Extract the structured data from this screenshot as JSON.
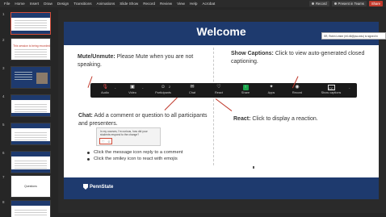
{
  "ribbon": {
    "menu": [
      "File",
      "Home",
      "Insert",
      "Draw",
      "Design",
      "Transitions",
      "Animations",
      "Slide Show",
      "Record",
      "Review",
      "View",
      "Help",
      "Acrobat"
    ],
    "record_label": "Record",
    "present_label": "Present in Teams",
    "share_label": "Share"
  },
  "thumbnails": [
    {
      "num": "1",
      "title": ""
    },
    {
      "num": "2",
      "title": "This session is being recorded"
    },
    {
      "num": "3",
      "title": ""
    },
    {
      "num": "4",
      "title": ""
    },
    {
      "num": "5",
      "title": ""
    },
    {
      "num": "6",
      "title": ""
    },
    {
      "num": "7",
      "title": "Questions"
    },
    {
      "num": "8",
      "title": ""
    },
    {
      "num": "9",
      "title": ""
    }
  ],
  "slide": {
    "title": "Welcome",
    "mute_heading": "Mute/Unmute:",
    "mute_text": "Please Mute when you are not speaking.",
    "captions_heading": "Show Captions:",
    "captions_text": "Click to view auto-generated closed captioning.",
    "chat_heading": "Chat:",
    "chat_text": "Add a comment or question to all participants and presenters.",
    "react_heading": "React:",
    "react_text": "Click to display a reaction.",
    "chat_example": "In my courses, I'm curious, how did your students respond to the change?",
    "chat_reactions": [
      "♡",
      "☺"
    ],
    "bullets": [
      "Click the message icon reply to a comment",
      "Click the smiley icon to react with emojis"
    ],
    "logo_text": "PennState"
  },
  "zoom_toolbar": [
    {
      "label": "Audio",
      "icon": "mic-off-icon",
      "glyph": "🎙"
    },
    {
      "label": "Video",
      "icon": "video-icon",
      "glyph": "▣"
    },
    {
      "label": "Participants",
      "icon": "participants-icon",
      "glyph": "☺"
    },
    {
      "label": "Chat",
      "icon": "chat-icon",
      "glyph": "✉"
    },
    {
      "label": "React",
      "icon": "heart-icon",
      "glyph": "♡"
    },
    {
      "label": "Share",
      "icon": "share-icon",
      "glyph": "↑"
    },
    {
      "label": "Apps",
      "icon": "apps-icon",
      "glyph": "✦"
    },
    {
      "label": "Record",
      "icon": "record-icon",
      "glyph": "◉"
    },
    {
      "label": "Show captions",
      "icon": "cc-icon",
      "glyph": "CC"
    }
  ],
  "participants_count": "2",
  "tooltip": "SR, Robin Lester (rlr146@psu.edu) is signed in",
  "colors": {
    "header": "#1e3a6e",
    "arrow": "#c0392b",
    "share_button": "#c0392b"
  }
}
